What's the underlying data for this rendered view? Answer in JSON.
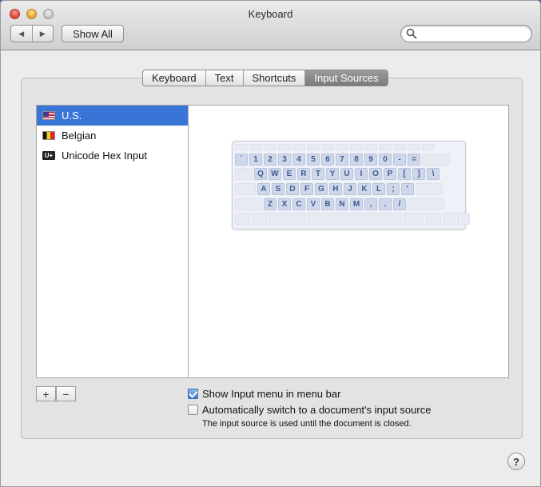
{
  "window": {
    "title": "Keyboard"
  },
  "toolbar": {
    "back_glyph": "◀",
    "forward_glyph": "▶",
    "show_all_label": "Show All",
    "search_placeholder": "",
    "search_value": ""
  },
  "tabs": [
    {
      "label": "Keyboard",
      "selected": false
    },
    {
      "label": "Text",
      "selected": false
    },
    {
      "label": "Shortcuts",
      "selected": false
    },
    {
      "label": "Input Sources",
      "selected": true
    }
  ],
  "input_sources": [
    {
      "label": "U.S.",
      "flag": "us-flag-icon",
      "selected": true
    },
    {
      "label": "Belgian",
      "flag": "belgian-flag-icon",
      "selected": false
    },
    {
      "label": "Unicode Hex Input",
      "flag": "unicode-hex-icon",
      "badge": "U+",
      "selected": false
    }
  ],
  "keyboard_preview": {
    "rows": [
      [
        "`",
        "1",
        "2",
        "3",
        "4",
        "5",
        "6",
        "7",
        "8",
        "9",
        "0",
        "-",
        "="
      ],
      [
        "Q",
        "W",
        "E",
        "R",
        "T",
        "Y",
        "U",
        "I",
        "O",
        "P",
        "[",
        "]",
        "\\"
      ],
      [
        "A",
        "S",
        "D",
        "F",
        "G",
        "H",
        "J",
        "K",
        "L",
        ";",
        "'"
      ],
      [
        "Z",
        "X",
        "C",
        "V",
        "B",
        "N",
        "M",
        ",",
        ".",
        "/"
      ]
    ]
  },
  "list_controls": {
    "add_label": "+",
    "remove_label": "−"
  },
  "options": {
    "show_input_menu": {
      "label": "Show Input menu in menu bar",
      "checked": true
    },
    "auto_switch": {
      "label": "Automatically switch to a document's input source",
      "checked": false
    },
    "note": "The input source is used until the document is closed."
  },
  "help": {
    "label": "?"
  },
  "colors": {
    "selection": "#3875d7",
    "key_text": "#415a94"
  }
}
